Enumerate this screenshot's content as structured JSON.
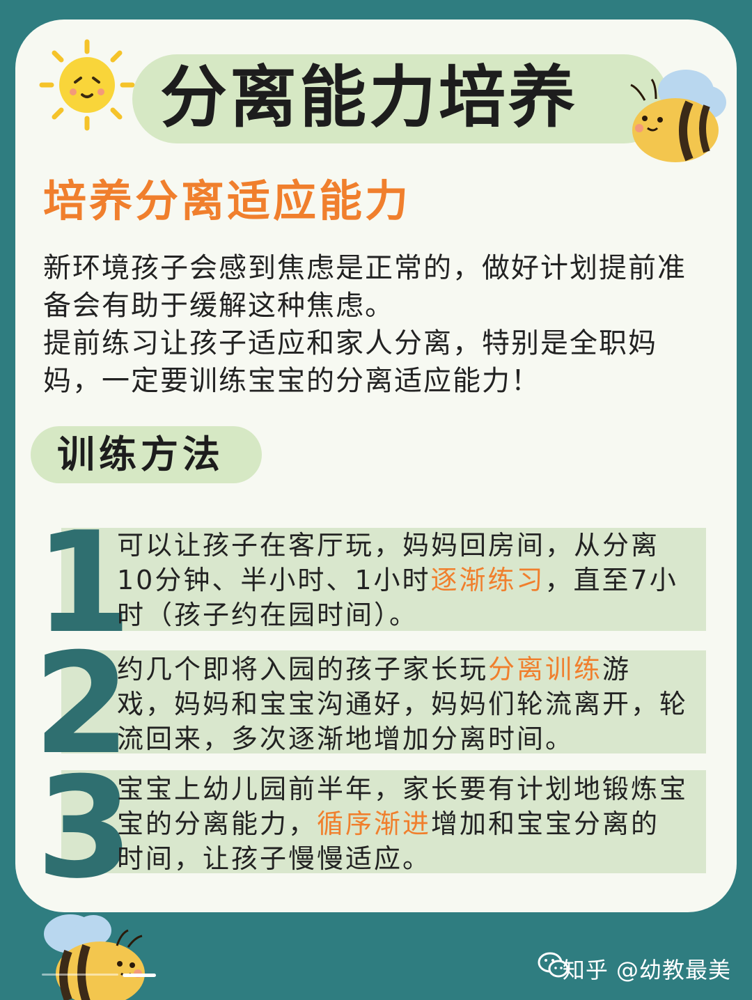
{
  "header": {
    "title": "分离能力培养"
  },
  "subtitle": "培养分离适应能力",
  "intro": [
    "新环境孩子会感到焦虑是正常的，做好计划提前准备会有助于缓解这种焦虑。",
    "提前练习让孩子适应和家人分离，特别是全职妈妈，一定要训练宝宝的分离适应能力！"
  ],
  "method_label": "训练方法",
  "steps": [
    {
      "number": "1",
      "before": "可以让孩子在客厅玩，妈妈回房间，从分离10分钟、半小时、1小时",
      "highlight": "逐渐练习",
      "after": "，直至7小时（孩子约在园时间）。"
    },
    {
      "number": "2",
      "before": "约几个即将入园的孩子家长玩",
      "highlight": "分离训练",
      "after": "游戏，妈妈和宝宝沟通好，妈妈们轮流离开，轮流回来，多次逐渐地增加分离时间。"
    },
    {
      "number": "3",
      "before": "宝宝上幼儿园前半年，家长要有计划地锻炼宝宝的分离能力，",
      "highlight": "循序渐进",
      "after": "增加和宝宝分离的时间，让孩子慢慢适应。"
    }
  ],
  "watermark": "知乎 @幼教最美",
  "colors": {
    "background": "#2f7d80",
    "accent": "#f07f2d",
    "pill": "#d6e8c4",
    "step_box": "#d9e7cd",
    "number": "#2f6f70"
  },
  "icons": [
    "sun-icon",
    "bee-icon",
    "wechat-icon"
  ]
}
